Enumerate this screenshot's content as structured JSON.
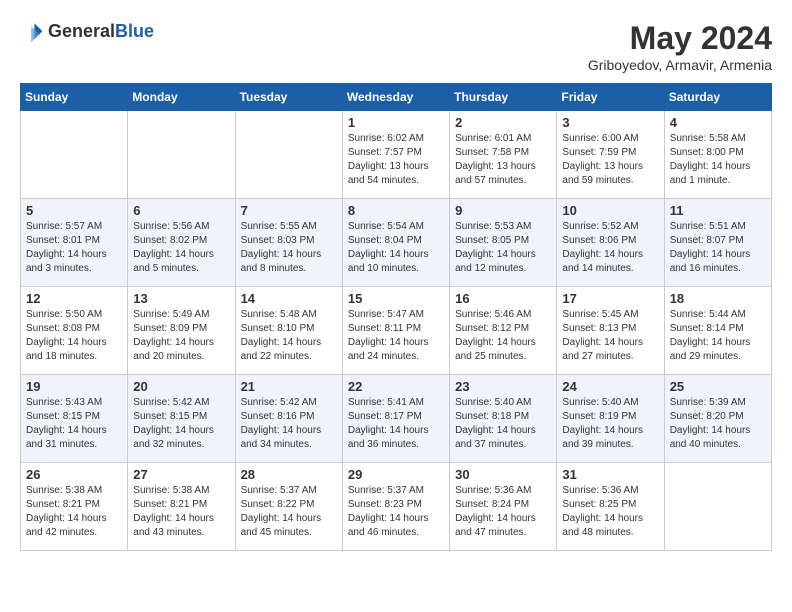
{
  "header": {
    "logo_line1": "General",
    "logo_line2": "Blue",
    "month": "May 2024",
    "location": "Griboyedov, Armavir, Armenia"
  },
  "days_of_week": [
    "Sunday",
    "Monday",
    "Tuesday",
    "Wednesday",
    "Thursday",
    "Friday",
    "Saturday"
  ],
  "weeks": [
    [
      {
        "day": "",
        "info": ""
      },
      {
        "day": "",
        "info": ""
      },
      {
        "day": "",
        "info": ""
      },
      {
        "day": "1",
        "info": "Sunrise: 6:02 AM\nSunset: 7:57 PM\nDaylight: 13 hours\nand 54 minutes."
      },
      {
        "day": "2",
        "info": "Sunrise: 6:01 AM\nSunset: 7:58 PM\nDaylight: 13 hours\nand 57 minutes."
      },
      {
        "day": "3",
        "info": "Sunrise: 6:00 AM\nSunset: 7:59 PM\nDaylight: 13 hours\nand 59 minutes."
      },
      {
        "day": "4",
        "info": "Sunrise: 5:58 AM\nSunset: 8:00 PM\nDaylight: 14 hours\nand 1 minute."
      }
    ],
    [
      {
        "day": "5",
        "info": "Sunrise: 5:57 AM\nSunset: 8:01 PM\nDaylight: 14 hours\nand 3 minutes."
      },
      {
        "day": "6",
        "info": "Sunrise: 5:56 AM\nSunset: 8:02 PM\nDaylight: 14 hours\nand 5 minutes."
      },
      {
        "day": "7",
        "info": "Sunrise: 5:55 AM\nSunset: 8:03 PM\nDaylight: 14 hours\nand 8 minutes."
      },
      {
        "day": "8",
        "info": "Sunrise: 5:54 AM\nSunset: 8:04 PM\nDaylight: 14 hours\nand 10 minutes."
      },
      {
        "day": "9",
        "info": "Sunrise: 5:53 AM\nSunset: 8:05 PM\nDaylight: 14 hours\nand 12 minutes."
      },
      {
        "day": "10",
        "info": "Sunrise: 5:52 AM\nSunset: 8:06 PM\nDaylight: 14 hours\nand 14 minutes."
      },
      {
        "day": "11",
        "info": "Sunrise: 5:51 AM\nSunset: 8:07 PM\nDaylight: 14 hours\nand 16 minutes."
      }
    ],
    [
      {
        "day": "12",
        "info": "Sunrise: 5:50 AM\nSunset: 8:08 PM\nDaylight: 14 hours\nand 18 minutes."
      },
      {
        "day": "13",
        "info": "Sunrise: 5:49 AM\nSunset: 8:09 PM\nDaylight: 14 hours\nand 20 minutes."
      },
      {
        "day": "14",
        "info": "Sunrise: 5:48 AM\nSunset: 8:10 PM\nDaylight: 14 hours\nand 22 minutes."
      },
      {
        "day": "15",
        "info": "Sunrise: 5:47 AM\nSunset: 8:11 PM\nDaylight: 14 hours\nand 24 minutes."
      },
      {
        "day": "16",
        "info": "Sunrise: 5:46 AM\nSunset: 8:12 PM\nDaylight: 14 hours\nand 25 minutes."
      },
      {
        "day": "17",
        "info": "Sunrise: 5:45 AM\nSunset: 8:13 PM\nDaylight: 14 hours\nand 27 minutes."
      },
      {
        "day": "18",
        "info": "Sunrise: 5:44 AM\nSunset: 8:14 PM\nDaylight: 14 hours\nand 29 minutes."
      }
    ],
    [
      {
        "day": "19",
        "info": "Sunrise: 5:43 AM\nSunset: 8:15 PM\nDaylight: 14 hours\nand 31 minutes."
      },
      {
        "day": "20",
        "info": "Sunrise: 5:42 AM\nSunset: 8:15 PM\nDaylight: 14 hours\nand 32 minutes."
      },
      {
        "day": "21",
        "info": "Sunrise: 5:42 AM\nSunset: 8:16 PM\nDaylight: 14 hours\nand 34 minutes."
      },
      {
        "day": "22",
        "info": "Sunrise: 5:41 AM\nSunset: 8:17 PM\nDaylight: 14 hours\nand 36 minutes."
      },
      {
        "day": "23",
        "info": "Sunrise: 5:40 AM\nSunset: 8:18 PM\nDaylight: 14 hours\nand 37 minutes."
      },
      {
        "day": "24",
        "info": "Sunrise: 5:40 AM\nSunset: 8:19 PM\nDaylight: 14 hours\nand 39 minutes."
      },
      {
        "day": "25",
        "info": "Sunrise: 5:39 AM\nSunset: 8:20 PM\nDaylight: 14 hours\nand 40 minutes."
      }
    ],
    [
      {
        "day": "26",
        "info": "Sunrise: 5:38 AM\nSunset: 8:21 PM\nDaylight: 14 hours\nand 42 minutes."
      },
      {
        "day": "27",
        "info": "Sunrise: 5:38 AM\nSunset: 8:21 PM\nDaylight: 14 hours\nand 43 minutes."
      },
      {
        "day": "28",
        "info": "Sunrise: 5:37 AM\nSunset: 8:22 PM\nDaylight: 14 hours\nand 45 minutes."
      },
      {
        "day": "29",
        "info": "Sunrise: 5:37 AM\nSunset: 8:23 PM\nDaylight: 14 hours\nand 46 minutes."
      },
      {
        "day": "30",
        "info": "Sunrise: 5:36 AM\nSunset: 8:24 PM\nDaylight: 14 hours\nand 47 minutes."
      },
      {
        "day": "31",
        "info": "Sunrise: 5:36 AM\nSunset: 8:25 PM\nDaylight: 14 hours\nand 48 minutes."
      },
      {
        "day": "",
        "info": ""
      }
    ]
  ]
}
